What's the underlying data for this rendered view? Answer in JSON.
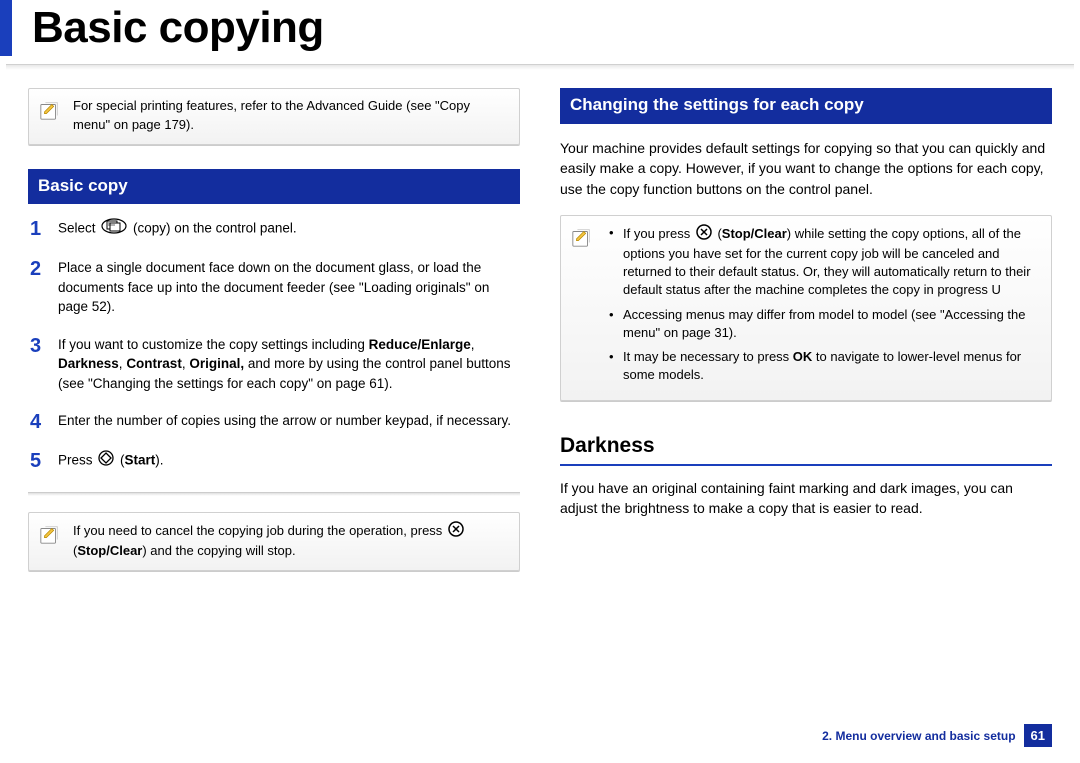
{
  "title": "Basic copying",
  "left": {
    "note1": "For special printing features, refer to the Advanced Guide (see \"Copy menu\" on page 179).",
    "section": "Basic copy",
    "steps": {
      "s1a": "Select ",
      "s1b": "(copy) on the control panel.",
      "s2": "Place a single document face down on the document glass, or load the documents face up into the document feeder (see \"Loading originals\" on page 52).",
      "s3a": "If you want to customize the copy settings including ",
      "s3b": "Reduce/Enlarge",
      "s3c": ", ",
      "s3d": "Darkness",
      "s3e": ", ",
      "s3f": "Contrast",
      "s3g": ", ",
      "s3h": "Original,",
      "s3i": " and more by using the control panel buttons (see \"Changing the settings for each copy\" on page 61).",
      "s4": "Enter the number of copies using the arrow or number keypad, if necessary.",
      "s5a": "Press ",
      "s5b": "(",
      "s5c": "Start",
      "s5d": ").",
      "n1": "1",
      "n2": "2",
      "n3": "3",
      "n4": "4",
      "n5": "5"
    },
    "note2a": "If you need to cancel the copying job during the operation, press ",
    "note2b": "(",
    "note2c": "Stop/Clear",
    "note2d": ") and the copying will stop."
  },
  "right": {
    "section": "Changing the settings for each copy",
    "intro": "Your machine provides default settings for copying so that you can quickly and easily make a copy. However, if you want to change the options for each copy, use the copy function buttons on the control panel.",
    "note": {
      "b1a": "If you press ",
      "b1b": "(",
      "b1c": "Stop/Clear",
      "b1d": ") while setting the copy options, all of the options you have set for the current copy job will be canceled and returned to their default status. Or, they will automatically return to their default status after the machine completes the copy in progress U",
      "b2": "Accessing menus may differ from model to model (see \"Accessing the menu\" on page 31).",
      "b3a": "It may be necessary to press ",
      "b3b": "OK",
      "b3c": " to navigate to lower-level menus for some models."
    },
    "subhead": "Darkness",
    "darkness_body": "If you have an original containing faint marking and dark images, you can adjust the brightness to make a copy that is easier to read."
  },
  "footer": {
    "chapter": "2.  Menu overview and basic setup",
    "page": "61"
  }
}
